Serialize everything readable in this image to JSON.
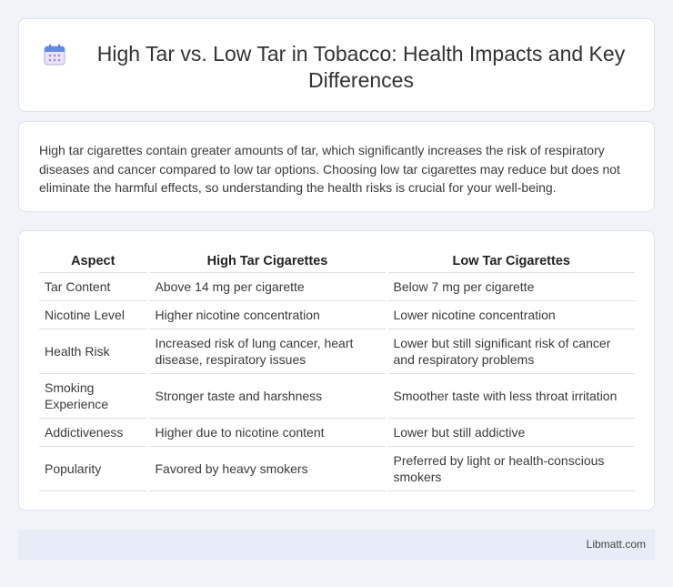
{
  "header": {
    "title": "High Tar vs. Low Tar in Tobacco: Health Impacts and Key Differences",
    "icon": "calendar-icon"
  },
  "summary": {
    "text": "High tar cigarettes contain greater amounts of tar, which significantly increases the risk of respiratory diseases and cancer compared to low tar options. Choosing low tar cigarettes may reduce but does not eliminate the harmful effects, so understanding the health risks is crucial for your well-being."
  },
  "table": {
    "headers": [
      "Aspect",
      "High Tar Cigarettes",
      "Low Tar Cigarettes"
    ],
    "rows": [
      [
        "Tar Content",
        "Above 14 mg per cigarette",
        "Below 7 mg per cigarette"
      ],
      [
        "Nicotine Level",
        "Higher nicotine concentration",
        "Lower nicotine concentration"
      ],
      [
        "Health Risk",
        "Increased risk of lung cancer, heart disease, respiratory issues",
        "Lower but still significant risk of cancer and respiratory problems"
      ],
      [
        "Smoking Experience",
        "Stronger taste and harshness",
        "Smoother taste with less throat irritation"
      ],
      [
        "Addictiveness",
        "Higher due to nicotine content",
        "Lower but still addictive"
      ],
      [
        "Popularity",
        "Favored by heavy smokers",
        "Preferred by light or health-conscious smokers"
      ]
    ]
  },
  "footer": {
    "site": "Libmatt.com"
  }
}
